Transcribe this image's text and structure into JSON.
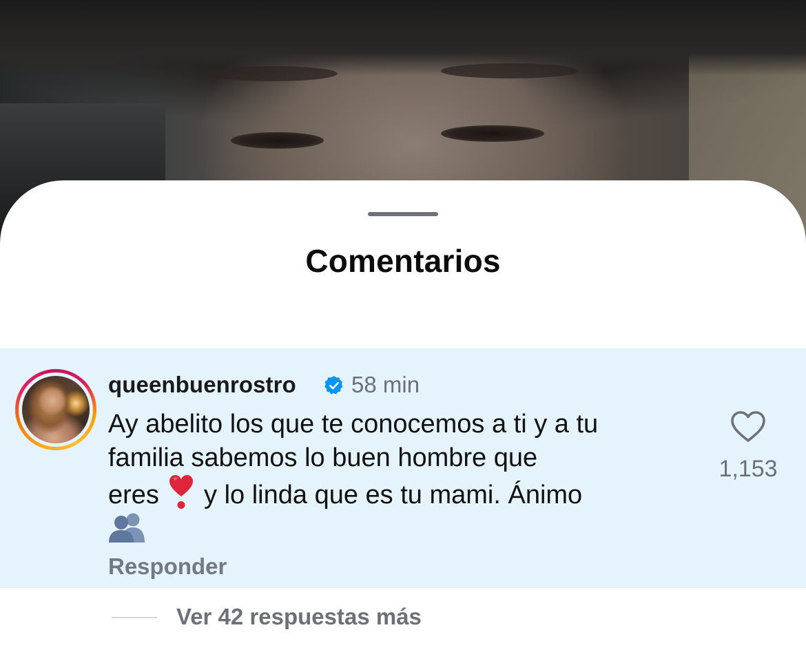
{
  "sheet": {
    "title": "Comentarios"
  },
  "comment": {
    "username": "queenbuenrostro",
    "verified": true,
    "timestamp": "58 min",
    "text_line1": "Ay abelito los que te conocemos a ti y a tu",
    "text_line2": "familia sabemos lo buen hombre que",
    "text_line3_pre": "eres ",
    "text_line3_post": " y lo linda que es tu mami. Ánimo",
    "emoji_1": "heavy-heart-exclamation",
    "emoji_2": "busts-in-silhouette",
    "reply_label": "Responder",
    "like_count": "1,153",
    "like_icon": "heart-outline-icon"
  },
  "replies": {
    "label": "Ver 42 respuestas más"
  },
  "colors": {
    "highlight_bg": "#e5f3fd",
    "verified_blue": "#0095f6",
    "muted_text": "#6c7177",
    "heart_red": "#e0243b"
  }
}
